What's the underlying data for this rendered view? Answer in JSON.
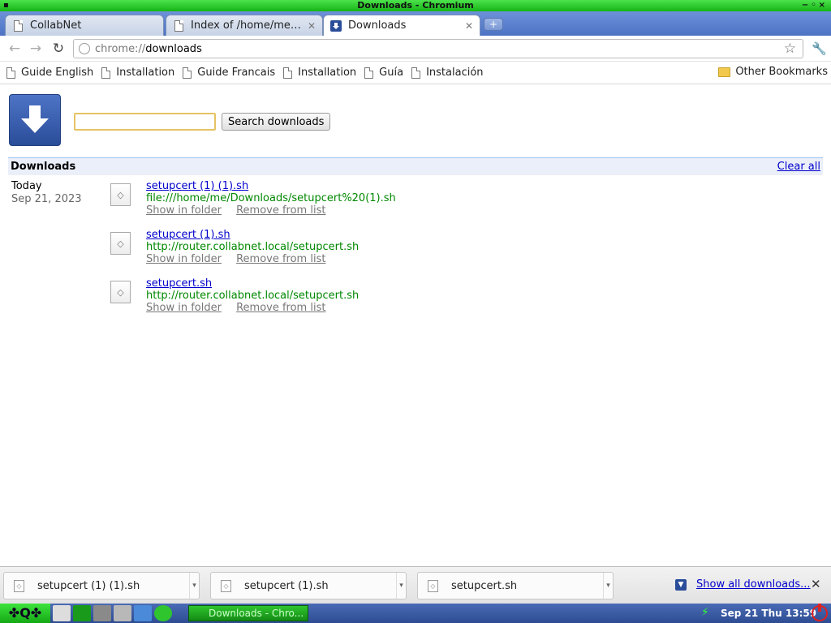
{
  "window": {
    "title": "Downloads - Chromium"
  },
  "tabs": [
    {
      "label": "CollabNet",
      "active": false
    },
    {
      "label": "Index of /home/me/D…",
      "active": false
    },
    {
      "label": "Downloads",
      "active": true
    }
  ],
  "toolbar": {
    "url_scheme": "chrome://",
    "url_host": "downloads"
  },
  "bookmarks": {
    "items": [
      "Guide English",
      "Installation",
      "Guide Francais",
      "Installation",
      "Guía",
      "Instalación"
    ],
    "other": "Other Bookmarks"
  },
  "downloads_page": {
    "search_button": "Search downloads",
    "search_value": "",
    "header_title": "Downloads",
    "clear_all": "Clear all",
    "date_today": "Today",
    "date": "Sep 21, 2023",
    "items": [
      {
        "name": "setupcert (1) (1).sh",
        "url": "file:///home/me/Downloads/setupcert%20(1).sh",
        "show_in_folder": "Show in folder",
        "remove": "Remove from list"
      },
      {
        "name": "setupcert (1).sh",
        "url": "http://router.collabnet.local/setupcert.sh",
        "show_in_folder": "Show in folder",
        "remove": "Remove from list"
      },
      {
        "name": "setupcert.sh",
        "url": "http://router.collabnet.local/setupcert.sh",
        "show_in_folder": "Show in folder",
        "remove": "Remove from list"
      }
    ]
  },
  "shelf": {
    "items": [
      "setupcert (1) (1).sh",
      "setupcert (1).sh",
      "setupcert.sh"
    ],
    "show_all": "Show all downloads..."
  },
  "taskbar": {
    "launcher": "✤Q✤",
    "task": "Downloads - Chro...",
    "clock": "Sep 21 Thu 13:59"
  }
}
